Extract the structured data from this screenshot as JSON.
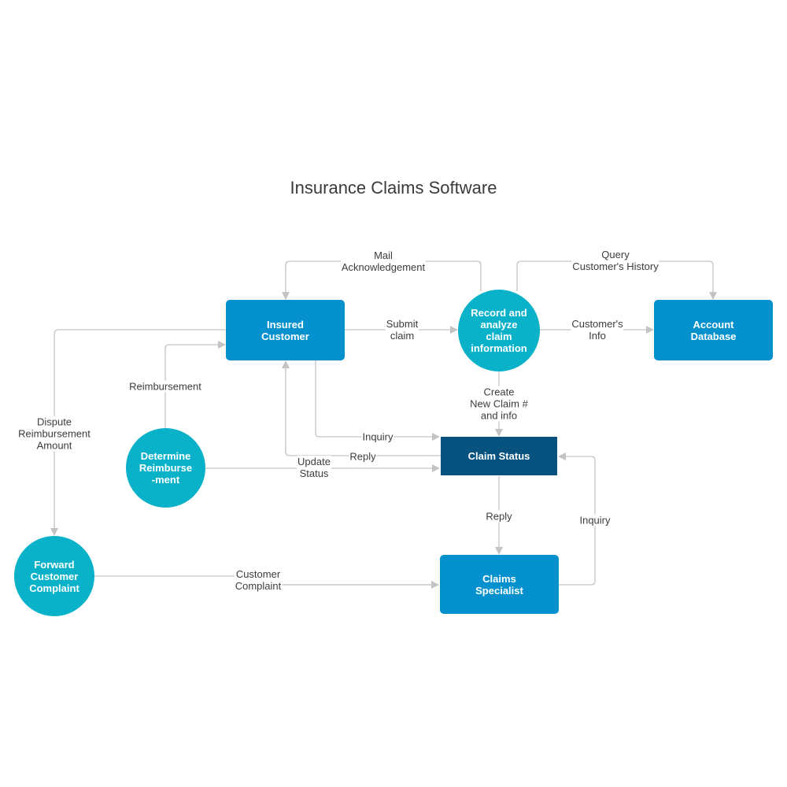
{
  "title": "Insurance Claims Software",
  "colors": {
    "entity": "#0591cd",
    "process": "#09b2c9",
    "datastore": "#07527f",
    "edge": "#c3c3c3"
  },
  "nodes": {
    "insured_customer": "Insured\nCustomer",
    "record_analyze": "Record and\nanalyze\nclaim\ninformation",
    "account_database": "Account\nDatabase",
    "claim_status": "Claim Status",
    "determine_reimbursement": "Determine\nReimburse\n-ment",
    "forward_complaint": "Forward\nCustomer\nComplaint",
    "claims_specialist": "Claims\nSpecialist"
  },
  "edges": {
    "mail_ack": "Mail\nAcknowledgement",
    "submit_claim": "Submit\nclaim",
    "query_history": "Query\nCustomer's History",
    "customers_info": "Customer's\nInfo",
    "reimbursement": "Reimbursement",
    "dispute": "Dispute\nReimbursement\nAmount",
    "create_claim": "Create\nNew Claim #\nand info",
    "inquiry_customer": "Inquiry",
    "reply_customer": "Reply",
    "update_status": "Update\nStatus",
    "reply_specialist": "Reply",
    "inquiry_specialist": "Inquiry",
    "customer_complaint": "Customer\nComplaint"
  }
}
